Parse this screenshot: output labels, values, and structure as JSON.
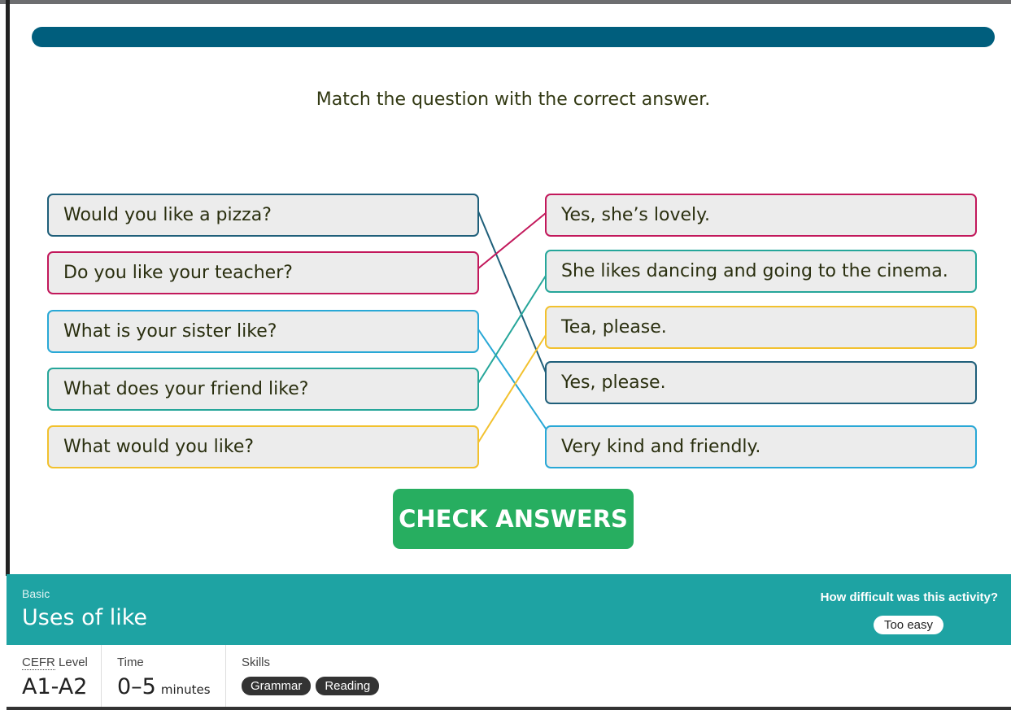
{
  "instruction": "Match the question with the correct answer.",
  "questions": [
    {
      "text": "Would you like a pizza?",
      "color": "#1f5f7a"
    },
    {
      "text": "Do you like your teacher?",
      "color": "#c2185b"
    },
    {
      "text": "What is your sister like?",
      "color": "#29a8d6"
    },
    {
      "text": "What does your friend like?",
      "color": "#26a69a"
    },
    {
      "text": "What would you like?",
      "color": "#f2c12e"
    }
  ],
  "answers": [
    {
      "text": "Yes, she’s lovely.",
      "color": "#c2185b"
    },
    {
      "text": "She likes dancing and going to the cinema.",
      "color": "#26a69a"
    },
    {
      "text": "Tea, please.",
      "color": "#f2c12e"
    },
    {
      "text": "Yes, please.",
      "color": "#1f5f7a"
    },
    {
      "text": "Very kind and friendly.",
      "color": "#29a8d6"
    }
  ],
  "matches": [
    [
      0,
      3
    ],
    [
      1,
      0
    ],
    [
      2,
      4
    ],
    [
      3,
      1
    ],
    [
      4,
      2
    ]
  ],
  "check_button": "CHECK ANSWERS",
  "activity": {
    "level": "Basic",
    "title": "Uses of like",
    "difficulty_question": "How difficult was this activity?",
    "difficulty_option": "Too easy"
  },
  "meta": {
    "cefr_abbr": "CEFR",
    "cefr_label_rest": " Level",
    "cefr_value": "A1-A2",
    "time_label": "Time",
    "time_value": "0–5",
    "time_unit": "minutes",
    "skills_label": "Skills",
    "skills": [
      "Grammar",
      "Reading"
    ]
  },
  "colors": {
    "progress": "#005e7d",
    "check_button": "#27ae60",
    "info_bar": "#1ea3a3"
  }
}
